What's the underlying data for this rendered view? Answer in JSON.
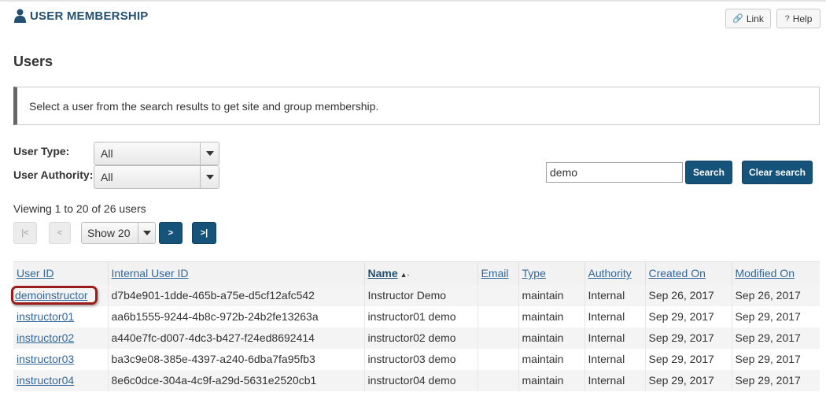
{
  "tool": {
    "title": "USER MEMBERSHIP",
    "icon": "user-icon"
  },
  "top_buttons": {
    "link_label": "Link",
    "help_label": "Help"
  },
  "page_title": "Users",
  "instruction": "Select a user from the search results to get site and group membership.",
  "filters": {
    "user_type_label": "User Type:",
    "user_type_value": "All",
    "user_authority_label": "User Authority:",
    "user_authority_value": "All"
  },
  "search": {
    "value": "demo",
    "search_label": "Search",
    "clear_label": "Clear search"
  },
  "viewing": "Viewing 1 to 20 of 26 users",
  "pager": {
    "first": "|<",
    "prev": "<",
    "show": "Show 20",
    "next": ">",
    "last": ">|"
  },
  "table": {
    "columns": [
      "User ID",
      "Internal User ID",
      "Name",
      "Email",
      "Type",
      "Authority",
      "Created On",
      "Modified On"
    ],
    "sorted_column": "Name",
    "rows": [
      [
        "demoinstructor",
        "d7b4e901-1dde-465b-a75e-d5cf12afc542",
        "Instructor Demo",
        "",
        "maintain",
        "Internal",
        "Sep 26, 2017",
        "Sep 26, 2017"
      ],
      [
        "instructor01",
        "aa6b1555-9244-4b8c-972b-24b2fe13263a",
        "instructor01 demo",
        "",
        "maintain",
        "Internal",
        "Sep 29, 2017",
        "Sep 29, 2017"
      ],
      [
        "instructor02",
        "a440e7fc-d007-4dc3-b427-f24ed8692414",
        "instructor02 demo",
        "",
        "maintain",
        "Internal",
        "Sep 29, 2017",
        "Sep 29, 2017"
      ],
      [
        "instructor03",
        "ba3c9e08-385e-4397-a240-6dba7fa95fb3",
        "instructor03 demo",
        "",
        "maintain",
        "Internal",
        "Sep 29, 2017",
        "Sep 29, 2017"
      ],
      [
        "instructor04",
        "8e6c0dce-304a-4c9f-a29d-5631e2520cb1",
        "instructor04 demo",
        "",
        "maintain",
        "Internal",
        "Sep 29, 2017",
        "Sep 29, 2017"
      ]
    ]
  },
  "colors": {
    "brand": "#15537b",
    "heading": "#245071",
    "link": "#336699",
    "highlight": "#9a1c1c"
  }
}
